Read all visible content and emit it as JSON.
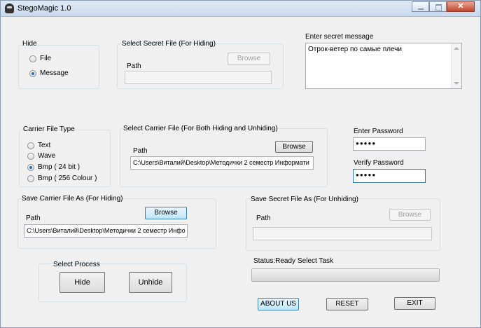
{
  "window": {
    "title": "StegoMagic 1.0",
    "close_glyph": "✕"
  },
  "hide": {
    "title": "Hide",
    "options": [
      "File",
      "Message"
    ],
    "selected": "Message"
  },
  "secret_file": {
    "title": "Select Secret File (For Hiding)",
    "browse": "Browse",
    "path_label": "Path",
    "path_value": ""
  },
  "secret_message": {
    "title": "Enter secret message",
    "value": "Отрок-ветер по самые плечи"
  },
  "carrier_type": {
    "title": "Carrier File Type",
    "options": [
      "Text",
      "Wave",
      "Bmp ( 24 bit )",
      "Bmp ( 256 Colour )"
    ],
    "selected": "Bmp ( 24 bit )"
  },
  "carrier_file": {
    "title": "Select Carrier File (For Both Hiding and Unhiding)",
    "browse": "Browse",
    "path_label": "Path",
    "path_value": "C:\\Users\\Виталий\\Desktop\\Методички 2 семестр Информати"
  },
  "password": {
    "enter_label": "Enter Password",
    "enter_value": "●●●●●",
    "verify_label": "Verify Password",
    "verify_value": "●●●●●"
  },
  "save_carrier": {
    "title": "Save Carrier File As (For Hiding)",
    "browse": "Browse",
    "path_label": "Path",
    "path_value": "C:\\Users\\Виталий\\Desktop\\Методички 2 семестр Инфо"
  },
  "save_secret": {
    "title": "Save Secret File As (For Unhiding)",
    "browse": "Browse",
    "path_label": "Path",
    "path_value": ""
  },
  "process": {
    "title": "Select Process",
    "hide": "Hide",
    "unhide": "Unhide"
  },
  "status": {
    "state": "Status:Ready",
    "task": "Select Task",
    "progress": 0
  },
  "actions": {
    "about": "ABOUT US",
    "reset": "RESET",
    "exit": "EXIT"
  }
}
